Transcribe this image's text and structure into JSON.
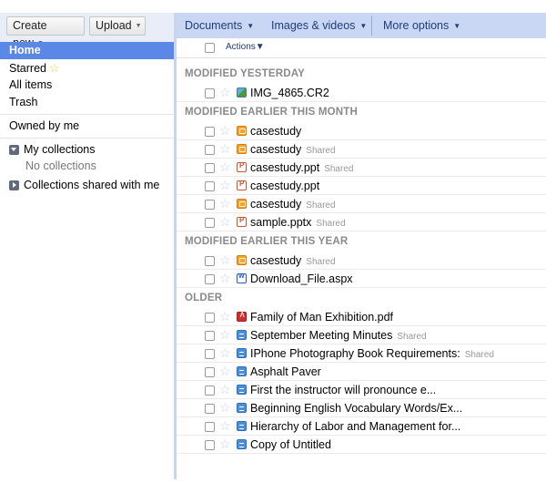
{
  "left_toolbar": {
    "create_new_label": "Create new",
    "upload_label": "Upload"
  },
  "sidebar": {
    "items": [
      {
        "label": "Home",
        "active": true
      },
      {
        "label": "Starred",
        "icon": "star-icon"
      },
      {
        "label": "All items"
      },
      {
        "label": "Trash"
      }
    ],
    "owned_by_me": "Owned by me",
    "my_collections": "My collections",
    "no_collections": "No collections",
    "collections_shared": "Collections shared with me"
  },
  "toolbar": {
    "documents_label": "Documents",
    "images_videos_label": "Images & videos",
    "more_options_label": "More options"
  },
  "actions_label": "Actions",
  "shared_label": "Shared",
  "sections": [
    {
      "title": "MODIFIED YESTERDAY",
      "files": [
        {
          "name": "IMG_4865.CR2",
          "type": "image",
          "shared": false
        }
      ]
    },
    {
      "title": "MODIFIED EARLIER THIS MONTH",
      "files": [
        {
          "name": "casestudy",
          "type": "folder",
          "shared": false
        },
        {
          "name": "casestudy",
          "type": "folder",
          "shared": true
        },
        {
          "name": "casestudy.ppt",
          "type": "ppt",
          "shared": true
        },
        {
          "name": "casestudy.ppt",
          "type": "ppt",
          "shared": false
        },
        {
          "name": "casestudy",
          "type": "folder",
          "shared": true
        },
        {
          "name": "sample.pptx",
          "type": "ppt",
          "shared": true
        }
      ]
    },
    {
      "title": "MODIFIED EARLIER THIS YEAR",
      "files": [
        {
          "name": "casestudy",
          "type": "folder",
          "shared": true
        },
        {
          "name": "Download_File.aspx",
          "type": "word",
          "shared": false
        }
      ]
    },
    {
      "title": "OLDER",
      "files": [
        {
          "name": "Family of Man Exhibition.pdf",
          "type": "pdf",
          "shared": false
        },
        {
          "name": "September Meeting Minutes",
          "type": "doc",
          "shared": true
        },
        {
          "name": "IPhone Photography Book Requirements:",
          "type": "doc",
          "shared": true
        },
        {
          "name": "Asphalt Paver",
          "type": "doc",
          "shared": false
        },
        {
          "name": "First the instructor will pronounce e...",
          "type": "doc",
          "shared": false
        },
        {
          "name": "Beginning English Vocabulary Words/Ex...",
          "type": "doc",
          "shared": false
        },
        {
          "name": "Hierarchy of Labor and Management for...",
          "type": "doc",
          "shared": false
        },
        {
          "name": "Copy of Untitled",
          "type": "doc",
          "shared": false
        }
      ]
    }
  ]
}
